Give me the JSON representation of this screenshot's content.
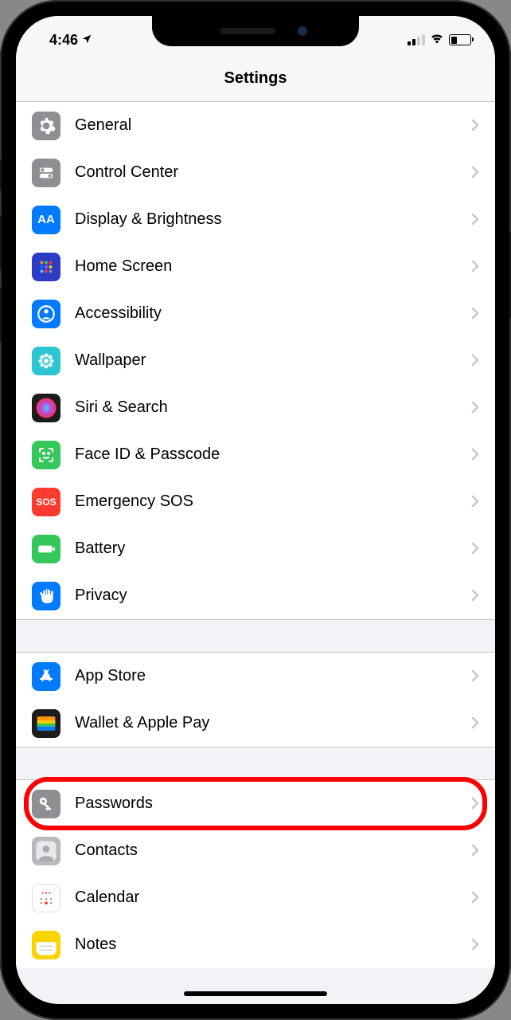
{
  "status": {
    "time": "4:46",
    "location_active": true
  },
  "header": {
    "title": "Settings"
  },
  "sections": [
    {
      "rows": [
        {
          "id": "general",
          "label": "General",
          "icon": "gear",
          "bg": "#8e8e93"
        },
        {
          "id": "control-center",
          "label": "Control Center",
          "icon": "toggles",
          "bg": "#8e8e93"
        },
        {
          "id": "display",
          "label": "Display & Brightness",
          "icon": "AA",
          "bg": "#007aff"
        },
        {
          "id": "home-screen",
          "label": "Home Screen",
          "icon": "grid",
          "bg": "#2d3cc7"
        },
        {
          "id": "accessibility",
          "label": "Accessibility",
          "icon": "person-circle",
          "bg": "#007aff"
        },
        {
          "id": "wallpaper",
          "label": "Wallpaper",
          "icon": "flower",
          "bg": "#2dc5d1"
        },
        {
          "id": "siri",
          "label": "Siri & Search",
          "icon": "siri",
          "bg": "#1c1c1e"
        },
        {
          "id": "faceid",
          "label": "Face ID & Passcode",
          "icon": "face",
          "bg": "#34c759"
        },
        {
          "id": "sos",
          "label": "Emergency SOS",
          "icon": "SOS",
          "bg": "#ff3b30"
        },
        {
          "id": "battery",
          "label": "Battery",
          "icon": "battery",
          "bg": "#34c759"
        },
        {
          "id": "privacy",
          "label": "Privacy",
          "icon": "hand",
          "bg": "#007aff"
        }
      ]
    },
    {
      "rows": [
        {
          "id": "appstore",
          "label": "App Store",
          "icon": "appstore",
          "bg": "#007aff"
        },
        {
          "id": "wallet",
          "label": "Wallet & Apple Pay",
          "icon": "wallet",
          "bg": "#1c1c1e"
        }
      ]
    },
    {
      "rows": [
        {
          "id": "passwords",
          "label": "Passwords",
          "icon": "key",
          "bg": "#8e8e93",
          "highlighted": true
        },
        {
          "id": "contacts",
          "label": "Contacts",
          "icon": "contacts",
          "bg": "#b8b8bd"
        },
        {
          "id": "calendar",
          "label": "Calendar",
          "icon": "calendar",
          "bg": "#ffffff"
        },
        {
          "id": "notes",
          "label": "Notes",
          "icon": "notes",
          "bg": "#fad400"
        }
      ]
    }
  ]
}
